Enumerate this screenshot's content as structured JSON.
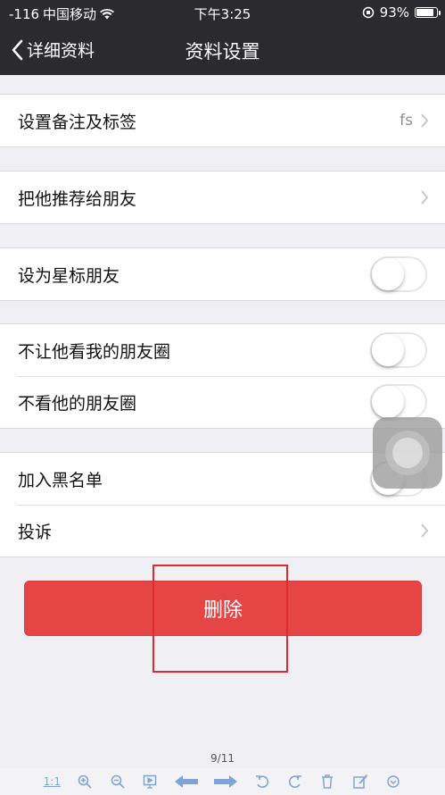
{
  "status_bar": {
    "signal": "-116",
    "carrier": "中国移动",
    "time": "下午3:25",
    "battery_percent": "93%",
    "battery_level": 0.93
  },
  "nav": {
    "back_label": "详细资料",
    "title": "资料设置"
  },
  "groups": [
    {
      "cells": [
        {
          "label": "设置备注及标签",
          "detail": "fs",
          "accessory": "chevron"
        }
      ]
    },
    {
      "cells": [
        {
          "label": "把他推荐给朋友",
          "accessory": "chevron"
        }
      ]
    },
    {
      "cells": [
        {
          "label": "设为星标朋友",
          "accessory": "toggle",
          "toggle_on": false
        }
      ]
    },
    {
      "cells": [
        {
          "label": "不让他看我的朋友圈",
          "accessory": "toggle",
          "toggle_on": false
        },
        {
          "label": "不看他的朋友圈",
          "accessory": "toggle",
          "toggle_on": false
        }
      ]
    },
    {
      "cells": [
        {
          "label": "加入黑名单",
          "accessory": "toggle",
          "toggle_on": false
        },
        {
          "label": "投诉",
          "accessory": "chevron"
        }
      ]
    }
  ],
  "delete_button_label": "删除",
  "viewer": {
    "page_indicator": "9/11",
    "actual_size_label": "1:1",
    "icons": [
      "actual-size-icon",
      "zoom-in-icon",
      "zoom-out-icon",
      "slideshow-icon",
      "prev-arrow-icon",
      "next-arrow-icon",
      "rotate-left-icon",
      "rotate-right-icon",
      "trash-icon",
      "edit-icon",
      "more-icon"
    ],
    "accent_color": "#7fa4d4"
  },
  "colors": {
    "nav_background": "#2b2b2f",
    "delete_button": "#e54545",
    "highlight_box": "#e0292e"
  }
}
